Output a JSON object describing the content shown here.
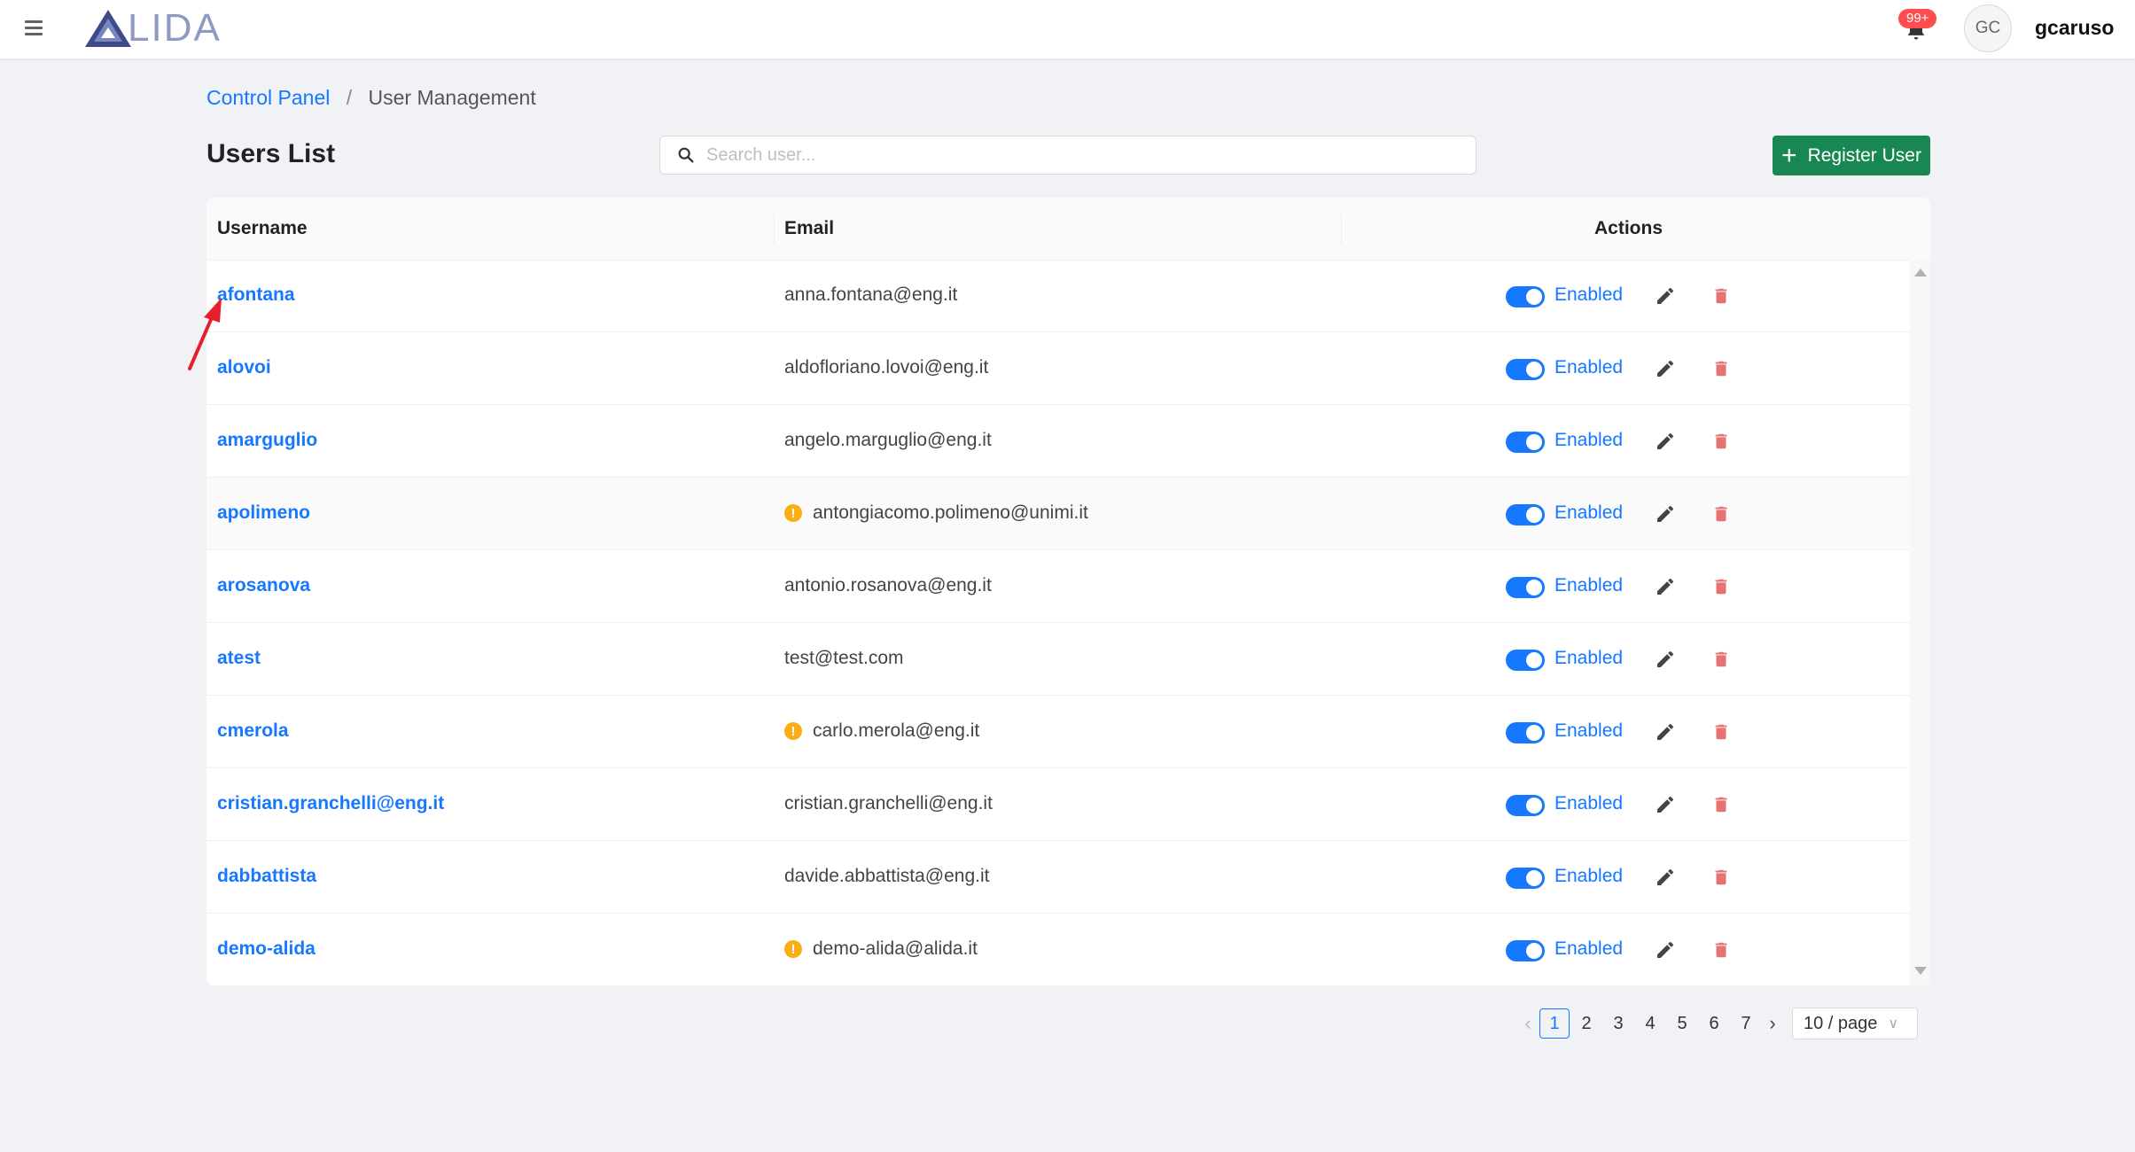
{
  "header": {
    "logo_text": "LIDA",
    "notification_badge": "99+",
    "avatar_initials": "GC",
    "username": "gcaruso"
  },
  "breadcrumb": {
    "root": "Control Panel",
    "separator": "/",
    "current": "User Management"
  },
  "page": {
    "title": "Users List",
    "search_placeholder": "Search user...",
    "register_label": "Register User"
  },
  "table": {
    "columns": [
      "Username",
      "Email",
      "Actions"
    ],
    "rows": [
      {
        "username": "afontana",
        "email": "anna.fontana@eng.it",
        "warning": false,
        "status": "Enabled"
      },
      {
        "username": "alovoi",
        "email": "aldofloriano.lovoi@eng.it",
        "warning": false,
        "status": "Enabled"
      },
      {
        "username": "amarguglio",
        "email": "angelo.marguglio@eng.it",
        "warning": false,
        "status": "Enabled"
      },
      {
        "username": "apolimeno",
        "email": "antongiacomo.polimeno@unimi.it",
        "warning": true,
        "status": "Enabled"
      },
      {
        "username": "arosanova",
        "email": "antonio.rosanova@eng.it",
        "warning": false,
        "status": "Enabled"
      },
      {
        "username": "atest",
        "email": "test@test.com",
        "warning": false,
        "status": "Enabled"
      },
      {
        "username": "cmerola",
        "email": "carlo.merola@eng.it",
        "warning": true,
        "status": "Enabled"
      },
      {
        "username": "cristian.granchelli@eng.it",
        "email": "cristian.granchelli@eng.it",
        "warning": false,
        "status": "Enabled"
      },
      {
        "username": "dabbattista",
        "email": "davide.abbattista@eng.it",
        "warning": false,
        "status": "Enabled"
      },
      {
        "username": "demo-alida",
        "email": "demo-alida@alida.it",
        "warning": true,
        "status": "Enabled"
      }
    ]
  },
  "pagination": {
    "pages": [
      "1",
      "2",
      "3",
      "4",
      "5",
      "6",
      "7"
    ],
    "current": "1",
    "page_size": "10 / page"
  },
  "colors": {
    "primary": "#1677ff",
    "register_button": "#198754",
    "delete_icon": "#e57373",
    "warning": "#faad14",
    "annotation_arrow": "#e5202a"
  }
}
